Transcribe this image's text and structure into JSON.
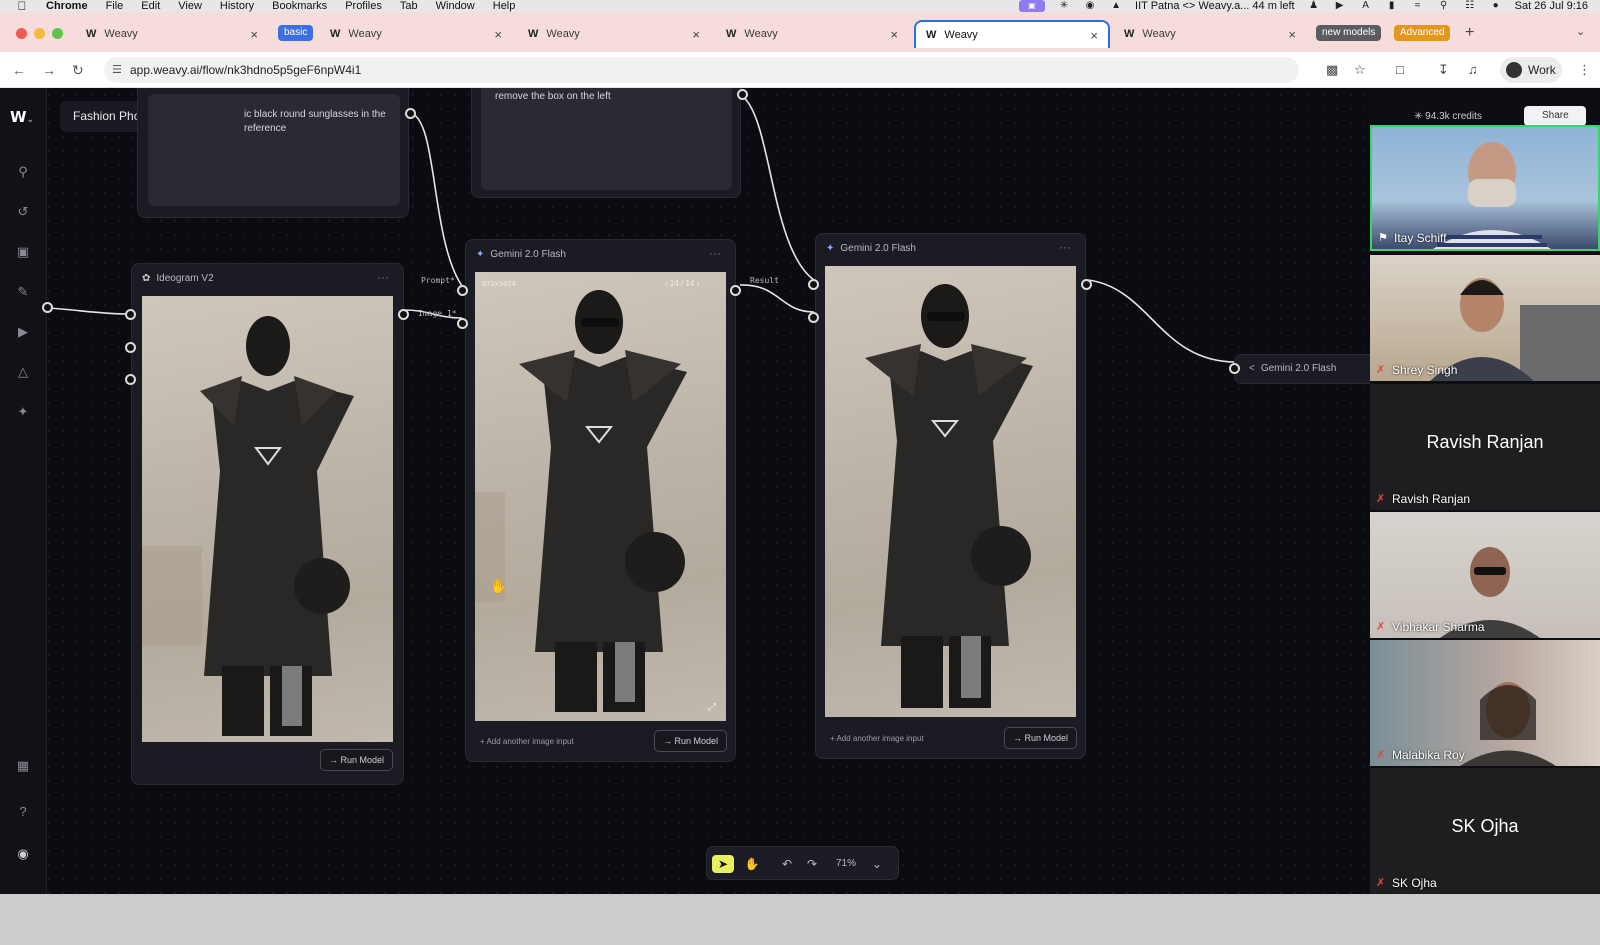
{
  "menubar": {
    "app": "Chrome",
    "items": [
      "File",
      "Edit",
      "View",
      "History",
      "Bookmarks",
      "Profiles",
      "Tab",
      "Window",
      "Help"
    ],
    "meeting": "IIT Patna <> Weavy.a... 44 m left",
    "clock": "Sat 26 Jul 9:16",
    "icons": [
      "meet-indicator-icon",
      "chatgpt-icon",
      "creative-cloud-icon",
      "a-icon",
      "accessibility-icon",
      "play-icon",
      "font-a-icon",
      "battery-icon",
      "wifi-icon",
      "search-icon",
      "control-center-icon",
      "siri-icon"
    ]
  },
  "tabs": [
    {
      "title": "Weavy",
      "group": ""
    },
    {
      "title": "Weavy",
      "group": "basic"
    },
    {
      "title": "Weavy",
      "group": ""
    },
    {
      "title": "Weavy",
      "group": ""
    },
    {
      "title": "Weavy",
      "group": "",
      "active": true
    },
    {
      "title": "Weavy",
      "group": ""
    }
  ],
  "tab_groups": {
    "new_models": "new models",
    "advanced": "Advanced",
    "basic": "basic"
  },
  "address": {
    "url": "app.weavy.ai/flow/nk3hdno5p5geF6npW4i1",
    "profile": "Work"
  },
  "project": {
    "name": "Fashion Photoshoot"
  },
  "prompts": {
    "left": "ic black round sunglasses in the\nreference",
    "mid": "remove the box on the left"
  },
  "nodes": {
    "ideogram": {
      "title": "Ideogram V2",
      "run": "Run Model"
    },
    "gemini1": {
      "title": "Gemini 2.0 Flash",
      "size": "672x1024",
      "pager": "14 / 14",
      "add": "Add another image input",
      "run": "Run Model"
    },
    "gemini2": {
      "title": "Gemini 2.0 Flash",
      "add": "Add another image input",
      "run": "Run Model"
    },
    "gemini3": {
      "title": "Gemini 2.0 Flash"
    }
  },
  "port_labels": {
    "prompt": "Prompt*",
    "image": "Image 1*",
    "result": "Result"
  },
  "toolbar": {
    "zoom": "71%"
  },
  "header": {
    "credits": "94.3k credits",
    "share": "Share"
  },
  "participants": [
    {
      "name": "Itay Schiff",
      "video": true
    },
    {
      "name": "Shrey Singh",
      "video": true
    },
    {
      "name": "Ravish Ranjan",
      "video": false
    },
    {
      "name": "Vibhakar Sharma",
      "video": true
    },
    {
      "name": "Malabika Roy",
      "video": true
    },
    {
      "name": "SK Ojha",
      "video": false
    }
  ],
  "colors": {
    "canvas": "#0b0b12",
    "node": "#1b1b23",
    "accent_select": "#e8f060",
    "active_speaker": "#3bd36c"
  }
}
